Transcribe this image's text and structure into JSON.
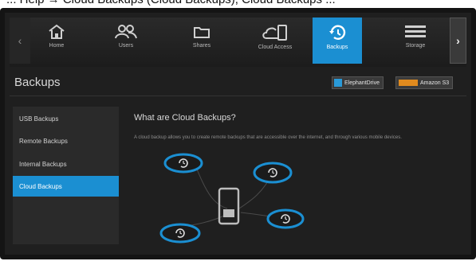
{
  "top_fragment": "... Help → Cloud Backups (Cloud Backups), Cloud Backups ...",
  "nav": {
    "items": [
      {
        "label": "Home",
        "icon": "home-icon"
      },
      {
        "label": "Users",
        "icon": "users-icon"
      },
      {
        "label": "Shares",
        "icon": "folder-icon"
      },
      {
        "label": "Cloud Access",
        "icon": "cloud-access-icon"
      },
      {
        "label": "Backups",
        "icon": "backup-clock-icon",
        "active": true
      },
      {
        "label": "Storage",
        "icon": "storage-icon"
      }
    ],
    "accent": "#1b8fd2"
  },
  "page": {
    "title": "Backups"
  },
  "providers": [
    {
      "label": "ElephantDrive"
    },
    {
      "label": "Amazon S3"
    }
  ],
  "sidebar": {
    "items": [
      {
        "label": "USB Backups"
      },
      {
        "label": "Remote Backups"
      },
      {
        "label": "Internal Backups"
      },
      {
        "label": "Cloud Backups",
        "active": true
      }
    ]
  },
  "main": {
    "heading": "What are Cloud Backups?",
    "description": "A cloud backup allows you to create remote backups that are accessible over the internet, and through various mobile devices."
  }
}
